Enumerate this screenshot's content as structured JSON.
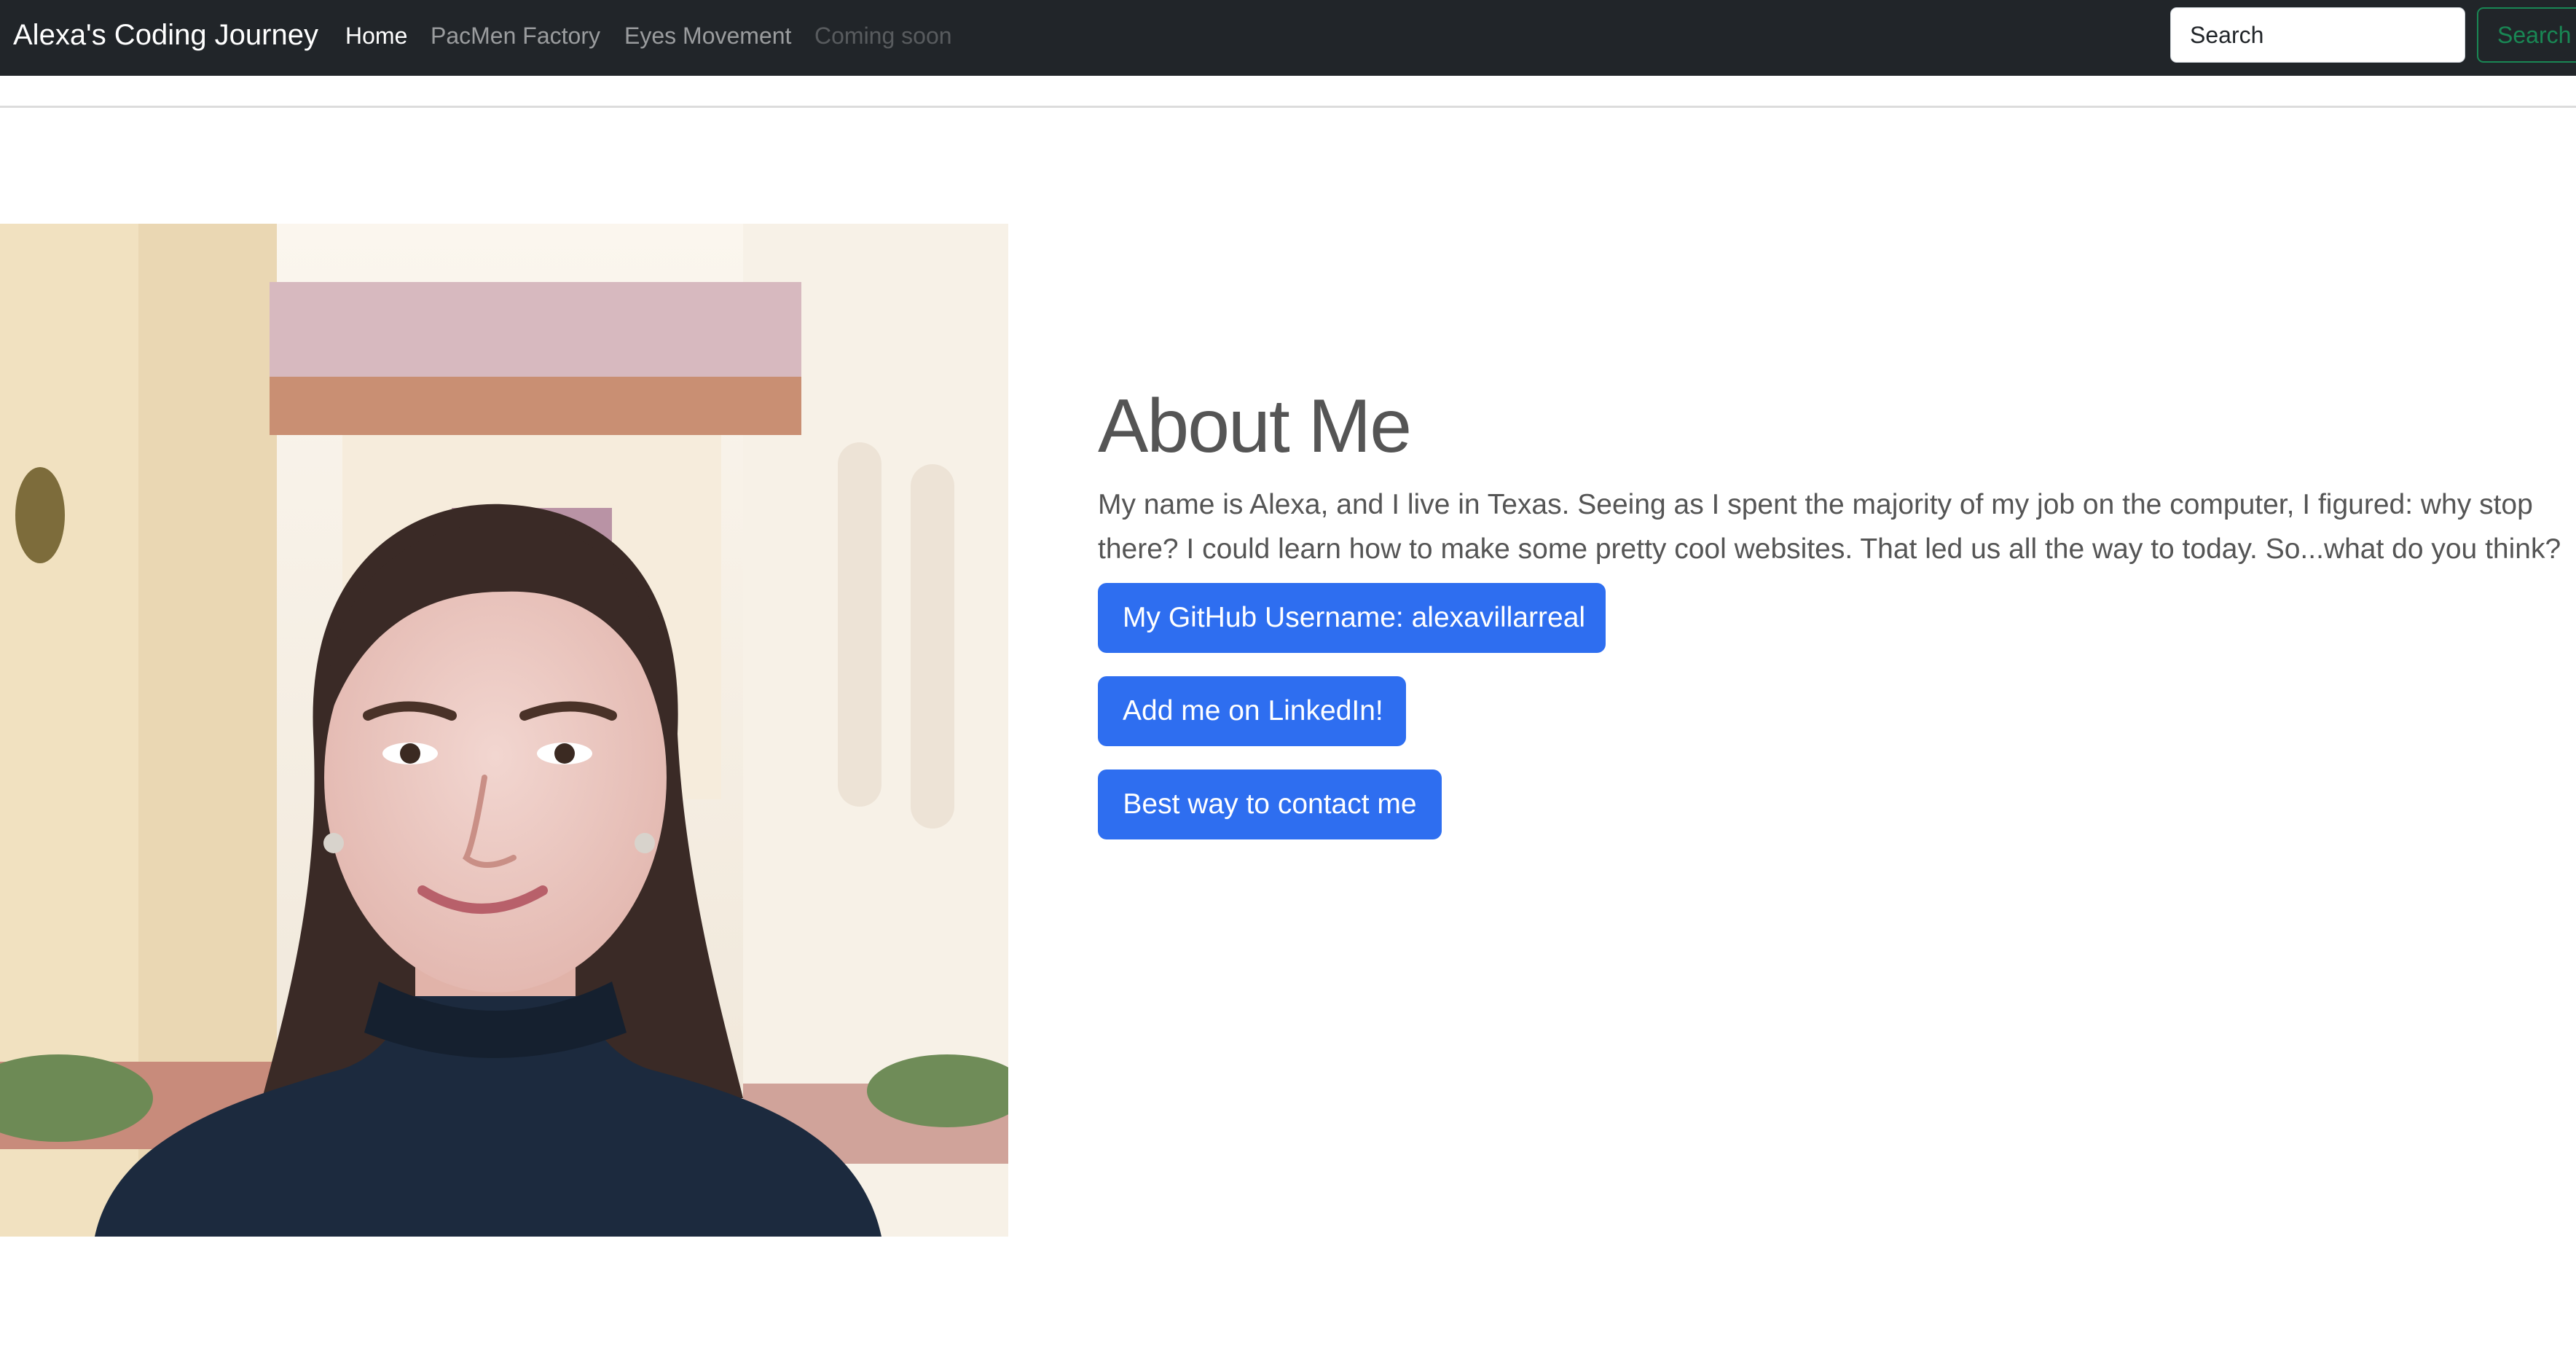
{
  "navbar": {
    "brand": "Alexa's Coding Journey",
    "links": [
      {
        "label": "Home",
        "state": "active"
      },
      {
        "label": "PacMen Factory",
        "state": "normal"
      },
      {
        "label": "Eyes Movement",
        "state": "normal"
      },
      {
        "label": "Coming soon",
        "state": "disabled"
      }
    ],
    "search": {
      "placeholder": "Search",
      "button_label": "Search"
    }
  },
  "about": {
    "title": "About Me",
    "text": "My name is Alexa, and I live in Texas. Seeing as I spent the majority of my job on the computer, I figured: why stop there? I could learn how to make some pretty cool websites. That led us all the way to today. So...what do you think?",
    "buttons": [
      {
        "label": "My GitHub Username: alexavillarreal"
      },
      {
        "label": "Add me on LinkedIn!"
      },
      {
        "label": "Best way to contact me"
      }
    ]
  },
  "colors": {
    "navbar_bg": "#212529",
    "primary": "#2e6ef0",
    "success": "#198754",
    "text": "#555555"
  }
}
